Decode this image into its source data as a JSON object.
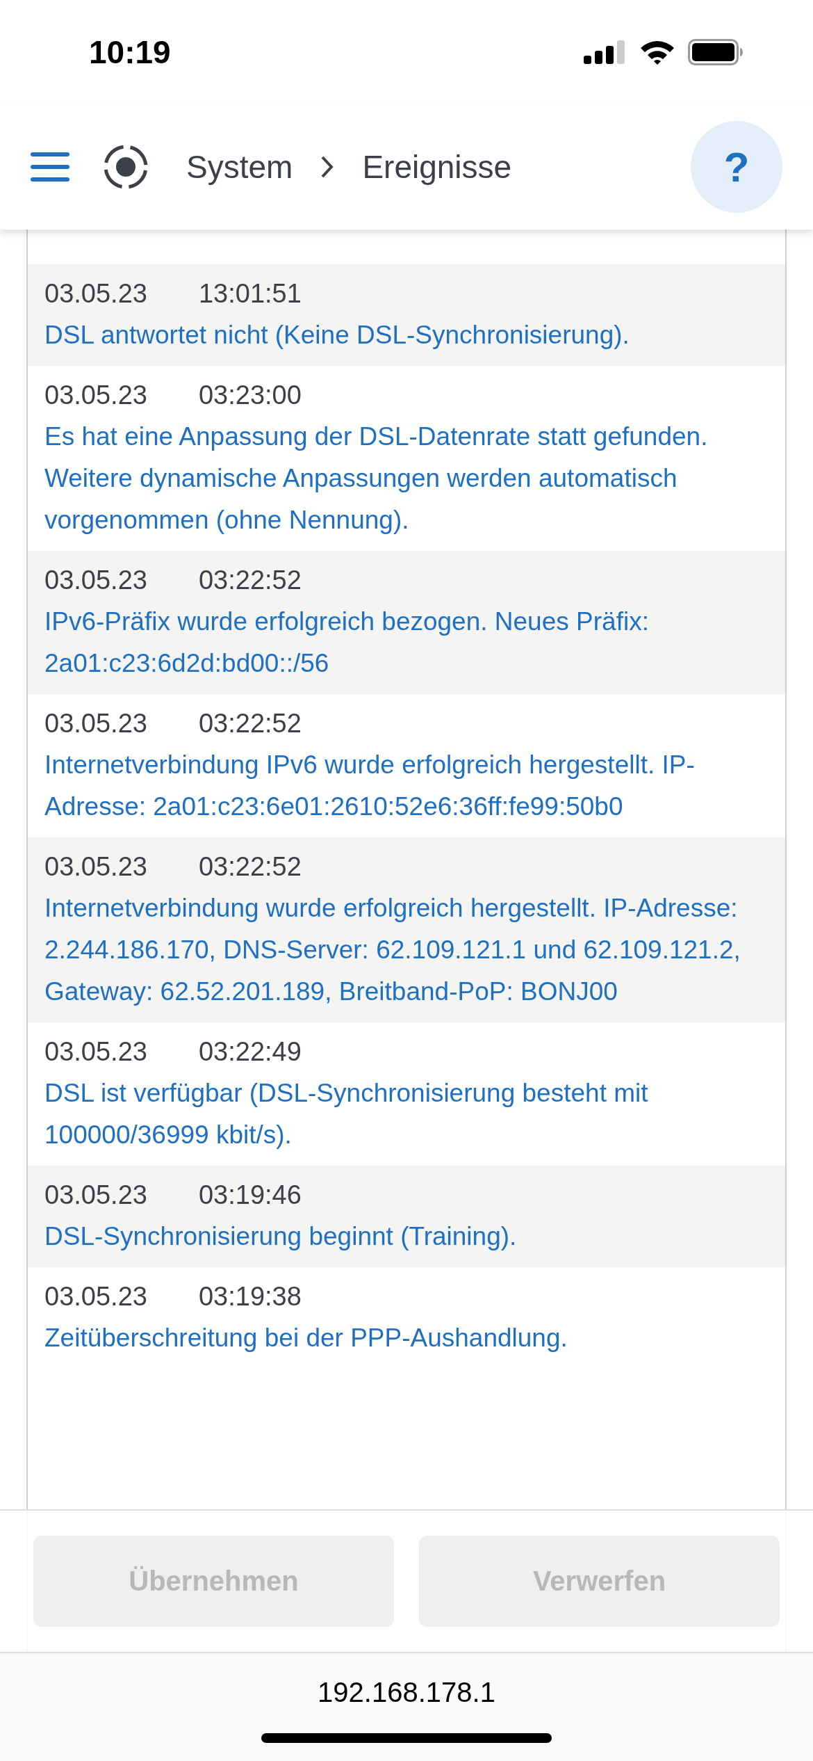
{
  "status_bar": {
    "time": "10:19"
  },
  "header": {
    "breadcrumb": [
      "System",
      "Ereignisse"
    ],
    "help": "?"
  },
  "events": [
    {
      "date": "03.05.23",
      "time": "13:01:51",
      "message": "DSL antwortet nicht (Keine DSL-Synchronisierung)."
    },
    {
      "date": "03.05.23",
      "time": "03:23:00",
      "message": "Es hat eine Anpassung der DSL-Datenrate statt gefunden. Weitere dynamische Anpassungen werden automatisch vorgenommen (ohne Nennung)."
    },
    {
      "date": "03.05.23",
      "time": "03:22:52",
      "message": "IPv6-Präfix wurde erfolgreich bezogen. Neues Präfix: 2a01:c23:6d2d:bd00::/56"
    },
    {
      "date": "03.05.23",
      "time": "03:22:52",
      "message": "Internetverbindung IPv6 wurde erfolgreich hergestellt. IP-Adresse: 2a01:c23:6e01:2610:52e6:36ff:fe99:50b0"
    },
    {
      "date": "03.05.23",
      "time": "03:22:52",
      "message": "Internetverbindung wurde erfolgreich hergestellt. IP-Adresse: 2.244.186.170, DNS-Server: 62.109.121.1 und 62.109.121.2, Gateway: 62.52.201.189, Breitband-PoP: BONJ00"
    },
    {
      "date": "03.05.23",
      "time": "03:22:49",
      "message": "DSL ist verfügbar (DSL-Synchronisierung besteht mit 100000/36999 kbit/s)."
    },
    {
      "date": "03.05.23",
      "time": "03:19:46",
      "message": "DSL-Synchronisierung beginnt (Training)."
    },
    {
      "date": "03.05.23",
      "time": "03:19:38",
      "message": "Zeitüberschreitung bei der PPP-Aushandlung."
    }
  ],
  "actions": [
    {
      "label": "Übernehmen",
      "disabled": true
    },
    {
      "label": "Verwerfen",
      "disabled": true
    }
  ],
  "url_bar": {
    "address": "192.168.178.1"
  }
}
